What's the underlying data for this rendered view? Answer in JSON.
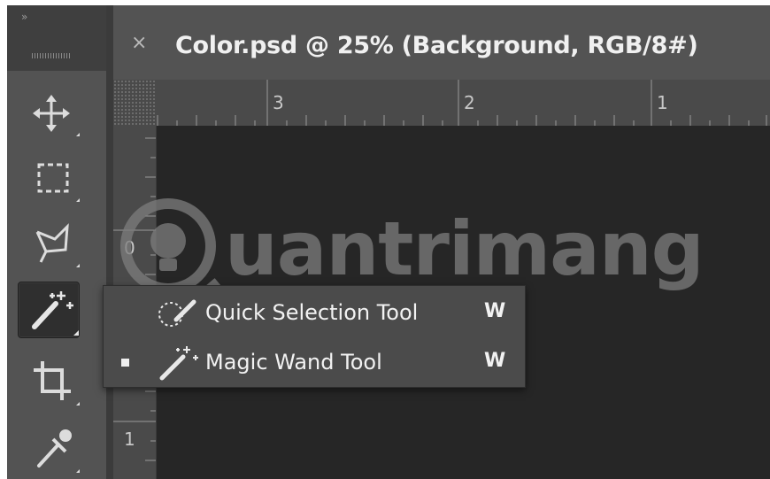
{
  "window": {
    "tab_close": "×",
    "tab_title": "Color.psd @ 25% (Background, RGB/8#)"
  },
  "toolbar": {
    "collapse_glyph": "»",
    "tools": [
      {
        "name": "move-tool",
        "icon": "move-icon"
      },
      {
        "name": "marquee-tool",
        "icon": "rectangular-marquee-icon"
      },
      {
        "name": "lasso-tool",
        "icon": "polygonal-lasso-icon"
      },
      {
        "name": "magic-wand-tool",
        "icon": "magic-wand-icon",
        "active": true
      },
      {
        "name": "crop-tool",
        "icon": "crop-icon"
      },
      {
        "name": "eyedropper-tool",
        "icon": "eyedropper-icon"
      }
    ]
  },
  "rulers": {
    "horizontal": [
      "3",
      "2",
      "1"
    ],
    "vertical": [
      "0",
      "1"
    ]
  },
  "watermark": {
    "text": "uantrimang"
  },
  "flyout": {
    "items": [
      {
        "label": "Quick Selection Tool",
        "shortcut": "W",
        "selected": false,
        "icon": "quick-selection-icon"
      },
      {
        "label": "Magic Wand Tool",
        "shortcut": "W",
        "selected": true,
        "icon": "magic-wand-icon"
      }
    ]
  },
  "colors": {
    "panel": "#535353",
    "canvas": "#262626",
    "flyout": "#4b4b4b",
    "text": "#f2f2f2"
  }
}
